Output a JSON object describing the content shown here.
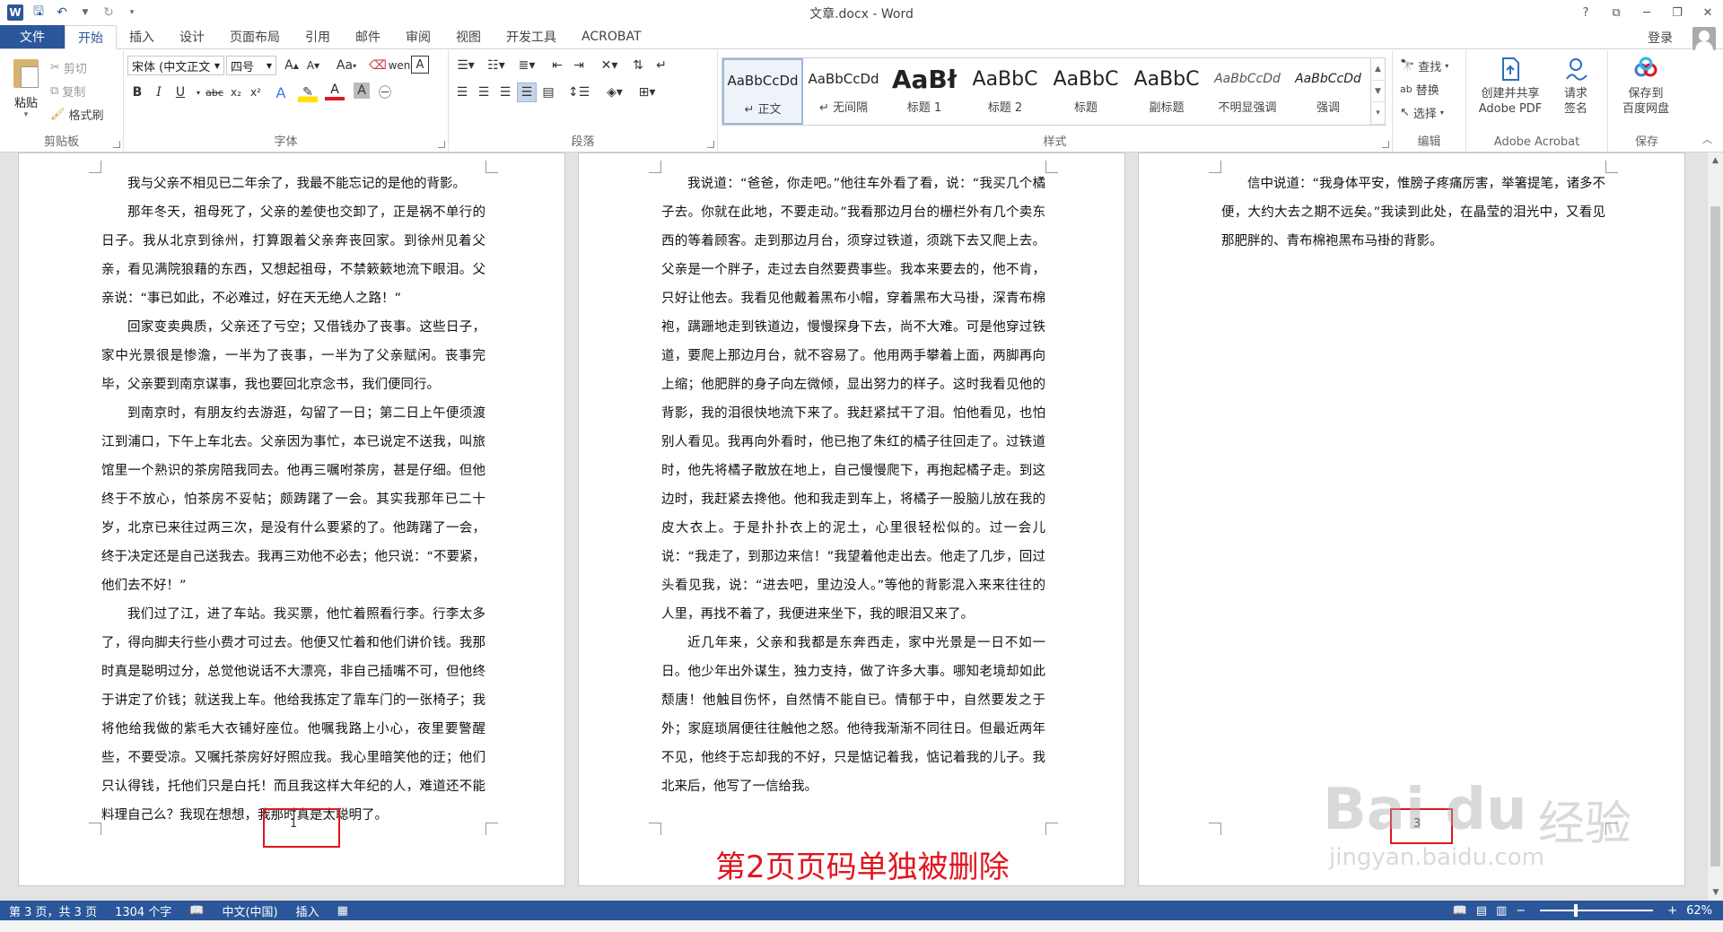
{
  "window": {
    "title": "文章.docx - Word",
    "help": "?",
    "restore_ribbon": "⧉",
    "minimize": "─",
    "maximize": "❐",
    "close": "✕"
  },
  "qat": {
    "app_icon": "W",
    "save_icon": "save-icon",
    "undo_icon": "undo-icon",
    "redo_icon": "redo-icon"
  },
  "tabs": [
    "文件",
    "开始",
    "插入",
    "设计",
    "页面布局",
    "引用",
    "邮件",
    "审阅",
    "视图",
    "开发工具",
    "ACROBAT"
  ],
  "login": "登录",
  "ribbon": {
    "clipboard": {
      "paste": "粘贴",
      "cut": "剪切",
      "copy": "复制",
      "format_painter": "格式刷",
      "label": "剪贴板"
    },
    "font": {
      "font_name": "宋体 (中文正文",
      "font_size": "四号",
      "label": "字体"
    },
    "paragraph": {
      "label": "段落"
    },
    "styles": {
      "items": [
        {
          "sample": "AaBbCcDd",
          "name": "↵ 正文"
        },
        {
          "sample": "AaBbCcDd",
          "name": "↵ 无间隔"
        },
        {
          "sample": "AaBł",
          "name": "标题 1"
        },
        {
          "sample": "AaBbC",
          "name": "标题 2"
        },
        {
          "sample": "AaBbC",
          "name": "标题"
        },
        {
          "sample": "AaBbC",
          "name": "副标题"
        },
        {
          "sample": "AaBbCcDd",
          "name": "不明显强调"
        },
        {
          "sample": "AaBbCcDd",
          "name": "强调"
        }
      ],
      "label": "样式"
    },
    "editing": {
      "find": "查找",
      "replace": "替换",
      "select": "选择",
      "label": "编辑"
    },
    "acrobat": {
      "create_line1": "创建并共享",
      "create_line2": "Adobe PDF",
      "request_line1": "请求",
      "request_line2": "签名",
      "label": "Adobe Acrobat"
    },
    "save": {
      "line1": "保存到",
      "line2": "百度网盘",
      "label": "保存"
    }
  },
  "pages": [
    {
      "paragraphs": [
        "我与父亲不相见已二年余了，我最不能忘记的是他的背影。",
        "那年冬天，祖母死了，父亲的差使也交卸了，正是祸不单行的日子。我从北京到徐州，打算跟着父亲奔丧回家。到徐州见着父亲，看见满院狼藉的东西，又想起祖母，不禁簌簌地流下眼泪。父亲说：“事已如此，不必难过，好在天无绝人之路！”",
        "回家变卖典质，父亲还了亏空；又借钱办了丧事。这些日子，家中光景很是惨澹，一半为了丧事，一半为了父亲赋闲。丧事完毕，父亲要到南京谋事，我也要回北京念书，我们便同行。",
        "到南京时，有朋友约去游逛，勾留了一日；第二日上午便须渡江到浦口，下午上车北去。父亲因为事忙，本已说定不送我，叫旅馆里一个熟识的茶房陪我同去。他再三嘱咐茶房，甚是仔细。但他终于不放心，怕茶房不妥帖；颇踌躇了一会。其实我那年已二十岁，北京已来往过两三次，是没有什么要紧的了。他踌躇了一会，终于决定还是自己送我去。我再三劝他不必去；他只说：“不要紧，他们去不好！”",
        "我们过了江，进了车站。我买票，他忙着照看行李。行李太多了，得向脚夫行些小费才可过去。他便又忙着和他们讲价钱。我那时真是聪明过分，总觉他说话不大漂亮，非自己插嘴不可，但他终于讲定了价钱；就送我上车。他给我拣定了靠车门的一张椅子；我将他给我做的紫毛大衣铺好座位。他嘱我路上小心，夜里要警醒些，不要受凉。又嘱托茶房好好照应我。我心里暗笑他的迂；他们只认得钱，托他们只是白托！而且我这样大年纪的人，难道还不能料理自己么？我现在想想，我那时真是太聪明了。"
      ],
      "page_number": "1"
    },
    {
      "paragraphs": [
        "我说道：“爸爸，你走吧。”他往车外看了看，说：“我买几个橘子去。你就在此地，不要走动。”我看那边月台的栅栏外有几个卖东西的等着顾客。走到那边月台，须穿过铁道，须跳下去又爬上去。父亲是一个胖子，走过去自然要费事些。我本来要去的，他不肯，只好让他去。我看见他戴着黑布小帽，穿着黑布大马褂，深青布棉袍，蹒跚地走到铁道边，慢慢探身下去，尚不大难。可是他穿过铁道，要爬上那边月台，就不容易了。他用两手攀着上面，两脚再向上缩；他肥胖的身子向左微倾，显出努力的样子。这时我看见他的背影，我的泪很快地流下来了。我赶紧拭干了泪。怕他看见，也怕别人看见。我再向外看时，他已抱了朱红的橘子往回走了。过铁道时，他先将橘子散放在地上，自己慢慢爬下，再抱起橘子走。到这边时，我赶紧去搀他。他和我走到车上，将橘子一股脑儿放在我的皮大衣上。于是扑扑衣上的泥土，心里很轻松似的。过一会儿说：“我走了，到那边来信！”我望着他走出去。他走了几步，回过头看见我，说：“进去吧，里边没人。”等他的背影混入来来往往的人里，再找不着了，我便进来坐下，我的眼泪又来了。",
        "近几年来，父亲和我都是东奔西走，家中光景是一日不如一日。他少年出外谋生，独力支持，做了许多大事。哪知老境却如此颓唐！他触目伤怀，自然情不能自已。情郁于中，自然要发之于外；家庭琐屑便往往触他之怒。他待我渐渐不同往日。但最近两年不见，他终于忘却我的不好，只是惦记着我，惦记着我的儿子。我北来后，他写了一信给我。"
      ],
      "page_number": ""
    },
    {
      "paragraphs": [
        "信中说道：“我身体平安，惟膀子疼痛厉害，举箸提笔，诸多不便，大约大去之期不远矣。”我读到此处，在晶莹的泪光中，又看见那肥胖的、青布棉袍黑布马褂的背影。"
      ],
      "page_number": "3"
    }
  ],
  "annotation": "第2页页码单独被删除",
  "watermark": {
    "logo": "Bai du",
    "jingyan": "经验",
    "url": "jingyan.baidu.com"
  },
  "status": {
    "page": "第 3 页，共 3 页",
    "words": "1304 个字",
    "language": "中文(中国)",
    "mode": "插入",
    "zoom": "62%"
  },
  "colors": {
    "accent": "#2b579a",
    "annotation": "#e0161f"
  }
}
